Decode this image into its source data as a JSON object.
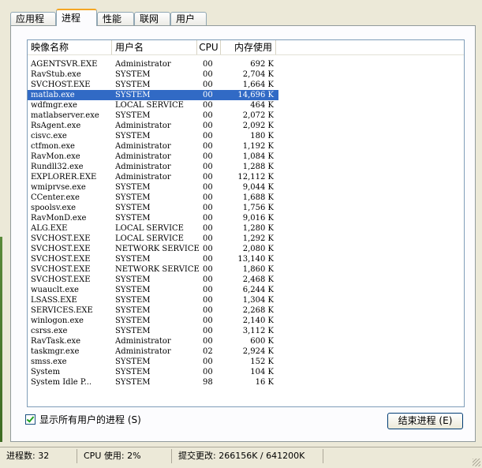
{
  "tabs": [
    "应用程序",
    "进程",
    "性能",
    "联网",
    "用户"
  ],
  "active_tab": 1,
  "columns": [
    "映像名称",
    "用户名",
    "CPU",
    "内存使用"
  ],
  "rows": [
    [
      "AGENTSVR.EXE",
      "Administrator",
      "00",
      "692 K"
    ],
    [
      "RavStub.exe",
      "SYSTEM",
      "00",
      "2,704 K"
    ],
    [
      "SVCHOST.EXE",
      "SYSTEM",
      "00",
      "1,664 K"
    ],
    [
      "matlab.exe",
      "SYSTEM",
      "00",
      "14,696 K"
    ],
    [
      "wdfmgr.exe",
      "LOCAL SERVICE",
      "00",
      "464 K"
    ],
    [
      "matlabserver.exe",
      "SYSTEM",
      "00",
      "2,072 K"
    ],
    [
      "RsAgent.exe",
      "Administrator",
      "00",
      "2,092 K"
    ],
    [
      "cisvc.exe",
      "SYSTEM",
      "00",
      "180 K"
    ],
    [
      "ctfmon.exe",
      "Administrator",
      "00",
      "1,192 K"
    ],
    [
      "RavMon.exe",
      "Administrator",
      "00",
      "1,084 K"
    ],
    [
      "Rundll32.exe",
      "Administrator",
      "00",
      "1,288 K"
    ],
    [
      "EXPLORER.EXE",
      "Administrator",
      "00",
      "12,112 K"
    ],
    [
      "wmiprvse.exe",
      "SYSTEM",
      "00",
      "9,044 K"
    ],
    [
      "CCenter.exe",
      "SYSTEM",
      "00",
      "1,688 K"
    ],
    [
      "spoolsv.exe",
      "SYSTEM",
      "00",
      "1,756 K"
    ],
    [
      "RavMonD.exe",
      "SYSTEM",
      "00",
      "9,016 K"
    ],
    [
      "ALG.EXE",
      "LOCAL SERVICE",
      "00",
      "1,280 K"
    ],
    [
      "SVCHOST.EXE",
      "LOCAL SERVICE",
      "00",
      "1,292 K"
    ],
    [
      "SVCHOST.EXE",
      "NETWORK SERVICE",
      "00",
      "2,080 K"
    ],
    [
      "SVCHOST.EXE",
      "SYSTEM",
      "00",
      "13,140 K"
    ],
    [
      "SVCHOST.EXE",
      "NETWORK SERVICE",
      "00",
      "1,860 K"
    ],
    [
      "SVCHOST.EXE",
      "SYSTEM",
      "00",
      "2,468 K"
    ],
    [
      "wuauclt.exe",
      "SYSTEM",
      "00",
      "6,244 K"
    ],
    [
      "LSASS.EXE",
      "SYSTEM",
      "00",
      "1,304 K"
    ],
    [
      "SERVICES.EXE",
      "SYSTEM",
      "00",
      "2,268 K"
    ],
    [
      "winlogon.exe",
      "SYSTEM",
      "00",
      "2,140 K"
    ],
    [
      "csrss.exe",
      "SYSTEM",
      "00",
      "3,112 K"
    ],
    [
      "RavTask.exe",
      "Administrator",
      "00",
      "600 K"
    ],
    [
      "taskmgr.exe",
      "Administrator",
      "02",
      "2,924 K"
    ],
    [
      "smss.exe",
      "SYSTEM",
      "00",
      "152 K"
    ],
    [
      "System",
      "SYSTEM",
      "00",
      "104 K"
    ],
    [
      "System Idle P...",
      "SYSTEM",
      "98",
      "16 K"
    ]
  ],
  "selected_row": 3,
  "show_all_label": "显示所有用户的进程 (S)",
  "show_all_checked": true,
  "end_button_label": "结束进程 (E)",
  "status": {
    "processes": "进程数: 32",
    "cpu": "CPU 使用: 2%",
    "commit": "提交更改: 266156K / 641200K"
  },
  "colors": {
    "selection": "#316ac5",
    "active_tab_accent": "#f5a623",
    "window_bg": "#ece9d8"
  }
}
